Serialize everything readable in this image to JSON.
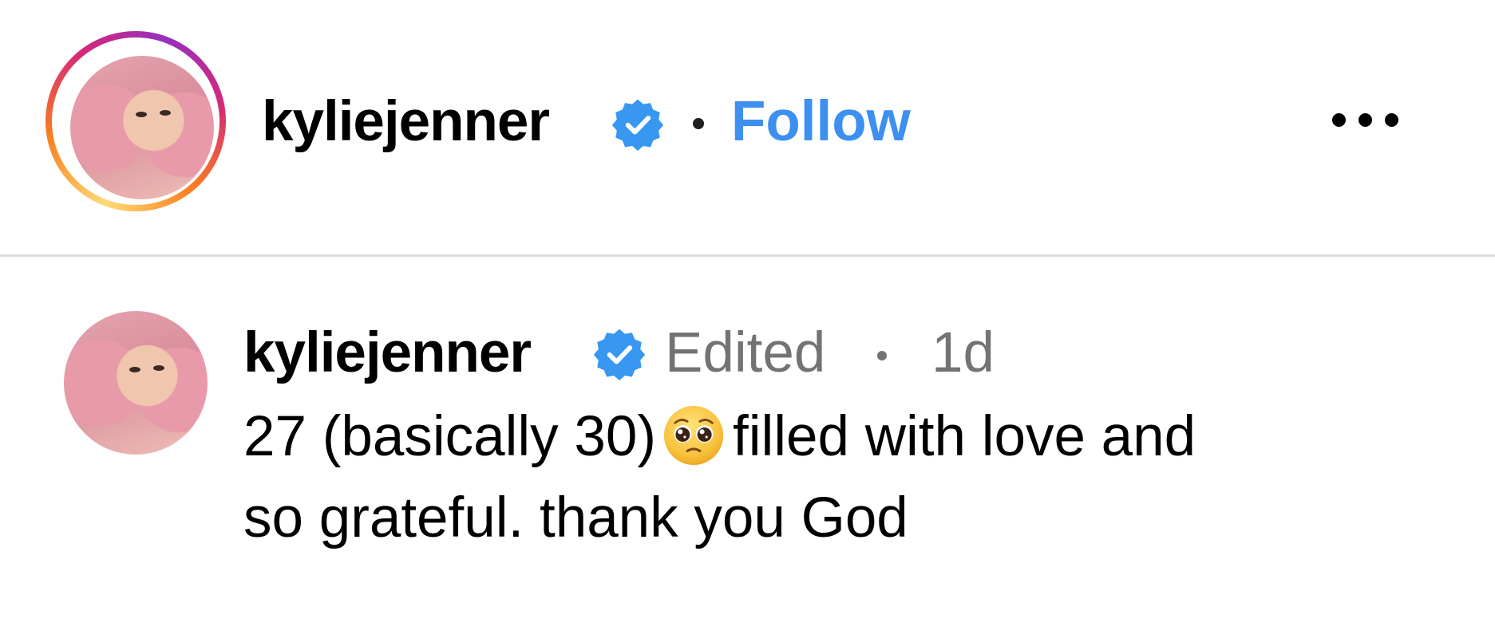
{
  "post_header": {
    "username": "kyliejenner",
    "verified_icon": "verified-badge-icon",
    "follow_label": "Follow",
    "more_icon": "more-options-icon",
    "story_ring_colors": [
      "#feda75",
      "#fa7e1e",
      "#d62976",
      "#962fbf"
    ]
  },
  "comment": {
    "username": "kyliejenner",
    "edited_label": "Edited",
    "time_label": "1d",
    "caption_line1_before_emoji": "27 (basically 30)",
    "caption_emoji_icon": "pleading-face-emoji",
    "caption_line1_after_emoji": "filled with love and",
    "caption_line2": "so grateful. thank you God"
  },
  "colors": {
    "follow_blue": "#3d8ff0",
    "verified_blue": "#3897f0",
    "secondary_text": "#737373",
    "divider": "#dcdcdc"
  }
}
